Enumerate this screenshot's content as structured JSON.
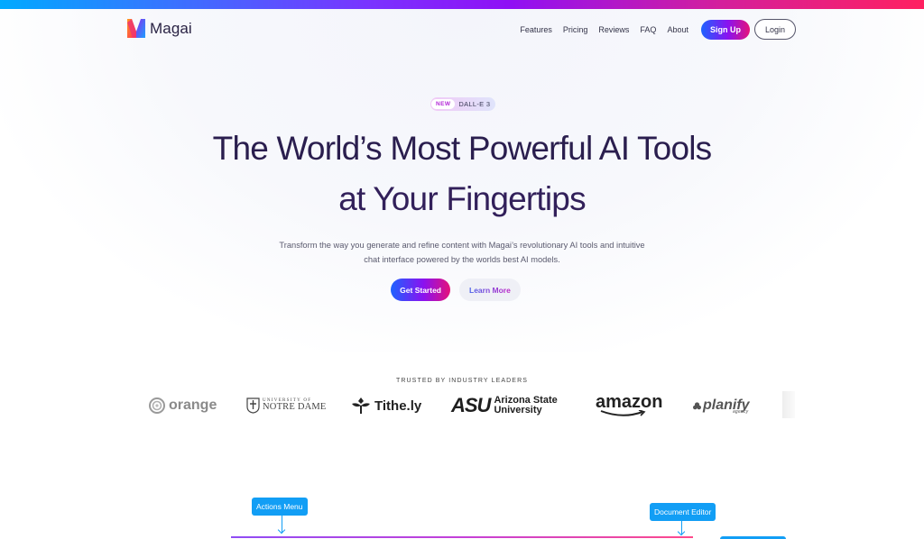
{
  "brand": {
    "name": "Magai"
  },
  "nav": {
    "links": [
      "Features",
      "Pricing",
      "Reviews",
      "FAQ",
      "About"
    ],
    "signup_label": "Sign Up",
    "login_label": "Login"
  },
  "hero": {
    "badge_new": "NEW",
    "badge_text": "DALL-E 3",
    "title_line1": "The World’s Most Powerful AI Tools",
    "title_line2": "at Your Fingertips",
    "subtitle_line1": "Transform the way you generate and refine content with Magai’s revolutionary AI tools and intuitive",
    "subtitle_line2": "chat interface powered by the worlds best AI models.",
    "get_started_label": "Get Started",
    "learn_more_label": "Learn More"
  },
  "trusted": {
    "heading": "TRUSTED BY INDUSTRY LEADERS",
    "logos": {
      "orange": "orange",
      "notre_dame_small": "UNIVERSITY OF",
      "notre_dame_big": "NOTRE DAME",
      "tithe": "Tithe.ly",
      "asu_mark": "ASU",
      "asu_line1": "Arizona State",
      "asu_line2": "University",
      "amazon": "amazon",
      "planify": "planify",
      "planify_sub": "agency"
    }
  },
  "annotations": {
    "actions_menu": "Actions Menu",
    "document_editor": "Document Editor"
  },
  "colors": {
    "accent_gradient_start": "#1e63ff",
    "accent_gradient_mid": "#8a12f0",
    "accent_gradient_end": "#e5127a",
    "heading": "#2a1e4e",
    "annotation_blue": "#129ef5"
  }
}
